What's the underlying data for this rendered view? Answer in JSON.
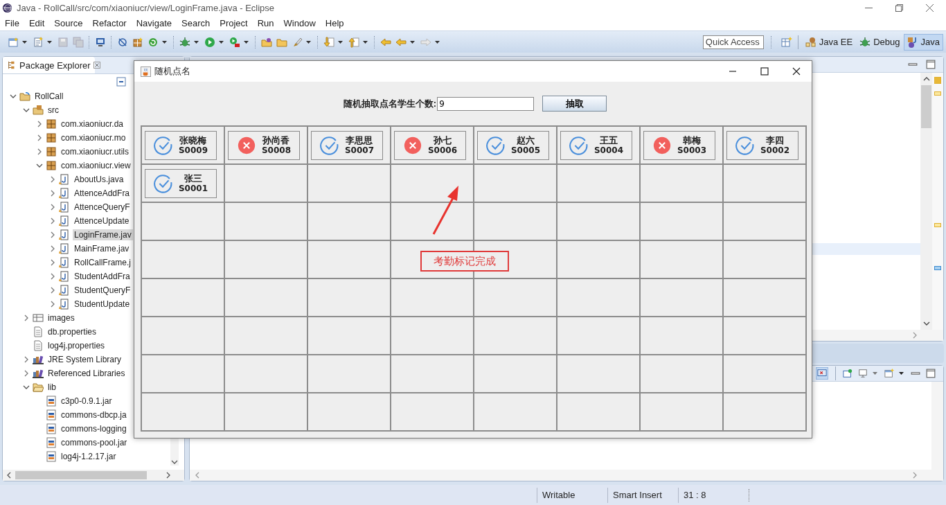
{
  "window": {
    "title": "Java - RollCall/src/com/xiaoniucr/view/LoginFrame.java - Eclipse"
  },
  "menu": [
    "File",
    "Edit",
    "Source",
    "Refactor",
    "Navigate",
    "Search",
    "Project",
    "Run",
    "Window",
    "Help"
  ],
  "toolbar": {
    "quick_access": {
      "placeholder": "Quick Access"
    },
    "perspectives": [
      {
        "label": "Java EE",
        "kind": "javaee",
        "selected": false
      },
      {
        "label": "Debug",
        "kind": "debug",
        "selected": false
      },
      {
        "label": "Java",
        "kind": "java",
        "selected": true
      }
    ]
  },
  "package_explorer": {
    "title": "Package Explorer",
    "tree": [
      {
        "label": "RollCall",
        "kind": "project",
        "expanded": true,
        "selected": false,
        "children": [
          {
            "label": "src",
            "kind": "source-folder",
            "expanded": true,
            "selected": false,
            "children": [
              {
                "label": "com.xiaoniucr.da",
                "kind": "package",
                "expanded": false,
                "selected": false
              },
              {
                "label": "com.xiaoniucr.mo",
                "kind": "package",
                "expanded": false,
                "selected": false
              },
              {
                "label": "com.xiaoniucr.utils",
                "kind": "package",
                "expanded": false,
                "selected": false
              },
              {
                "label": "com.xiaoniucr.view",
                "kind": "package",
                "expanded": true,
                "selected": false,
                "children": [
                  {
                    "label": "AboutUs.java",
                    "kind": "java",
                    "expanded": false,
                    "selected": false
                  },
                  {
                    "label": "AttenceAddFra",
                    "kind": "java",
                    "expanded": false,
                    "selected": false
                  },
                  {
                    "label": "AttenceQueryF",
                    "kind": "java",
                    "expanded": false,
                    "selected": false
                  },
                  {
                    "label": "AttenceUpdate",
                    "kind": "java",
                    "expanded": false,
                    "selected": false
                  },
                  {
                    "label": "LoginFrame.jav",
                    "kind": "java",
                    "expanded": false,
                    "selected": true
                  },
                  {
                    "label": "MainFrame.jav",
                    "kind": "java",
                    "expanded": false,
                    "selected": false
                  },
                  {
                    "label": "RollCallFrame.j",
                    "kind": "java",
                    "expanded": false,
                    "selected": false
                  },
                  {
                    "label": "StudentAddFra",
                    "kind": "java",
                    "expanded": false,
                    "selected": false
                  },
                  {
                    "label": "StudentQueryF",
                    "kind": "java",
                    "expanded": false,
                    "selected": false
                  },
                  {
                    "label": "StudentUpdate",
                    "kind": "java",
                    "expanded": false,
                    "selected": false
                  }
                ]
              }
            ]
          },
          {
            "label": "images",
            "kind": "images",
            "expanded": false,
            "selected": false
          },
          {
            "label": "db.properties",
            "kind": "file",
            "selected": false
          },
          {
            "label": "log4j.properties",
            "kind": "file",
            "selected": false
          },
          {
            "label": "JRE System Library",
            "kind": "library",
            "expanded": false,
            "selected": false
          },
          {
            "label": "Referenced Libraries",
            "kind": "library",
            "expanded": false,
            "selected": false
          },
          {
            "label": "lib",
            "kind": "folder",
            "expanded": true,
            "selected": false,
            "children": [
              {
                "label": "c3p0-0.9.1.jar",
                "kind": "jar",
                "selected": false
              },
              {
                "label": "commons-dbcp.ja",
                "kind": "jar",
                "selected": false
              },
              {
                "label": "commons-logging",
                "kind": "jar",
                "selected": false
              },
              {
                "label": "commons-pool.jar",
                "kind": "jar",
                "selected": false
              },
              {
                "label": "log4j-1.2.17.jar",
                "kind": "jar",
                "selected": false
              }
            ]
          }
        ]
      }
    ]
  },
  "dialog": {
    "title": "随机点名",
    "count_label": "随机抽取点名学生个数:",
    "count_value": "9",
    "draw_button": "抽取",
    "students": [
      {
        "name": "张晓梅",
        "id": "S0009",
        "present": true
      },
      {
        "name": "孙尚香",
        "id": "S0008",
        "present": false
      },
      {
        "name": "李思思",
        "id": "S0007",
        "present": true
      },
      {
        "name": "孙七",
        "id": "S0006",
        "present": false
      },
      {
        "name": "赵六",
        "id": "S0005",
        "present": true
      },
      {
        "name": "王五",
        "id": "S0004",
        "present": true
      },
      {
        "name": "韩梅",
        "id": "S0003",
        "present": false
      },
      {
        "name": "李四",
        "id": "S0002",
        "present": true
      },
      {
        "name": "张三",
        "id": "S0001",
        "present": true
      }
    ]
  },
  "annotation": {
    "text": "考勤标记完成"
  },
  "status_bar": [
    "Writable",
    "Smart Insert",
    "31 : 8"
  ]
}
